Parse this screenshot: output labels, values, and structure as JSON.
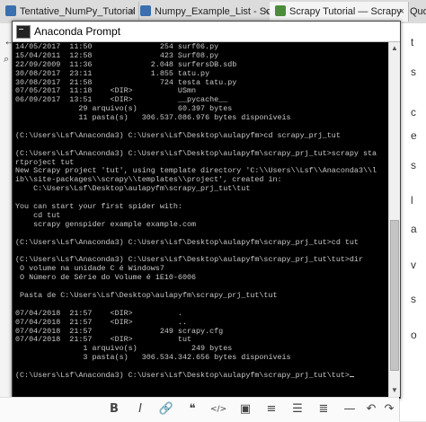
{
  "browser": {
    "tabs": [
      {
        "label": "Tentative_NumPy_Tutorial - S",
        "close": "×"
      },
      {
        "label": "Numpy_Example_List - SciPy",
        "close": "×"
      },
      {
        "label": "Scrapy Tutorial — Scrapy",
        "close": "×"
      },
      {
        "label": "Quo",
        "close": ""
      }
    ],
    "left_glyphs": [
      "←",
      "⌕"
    ],
    "right_glyphs": [
      "t",
      "s",
      "c",
      "e",
      "s",
      "l",
      "a",
      "v",
      "s",
      "o"
    ]
  },
  "window": {
    "title": "Anaconda Prompt",
    "console_lines": [
      "14/05/2017  11:50               254 surf06.py",
      "15/04/2011  12:58               423 Surf08.py",
      "22/09/2009  11:36             2.048 surfersDB.sdb",
      "30/08/2017  23:11             1.855 tatu.py",
      "30/08/2017  21:58               724 testa tatu.py",
      "07/05/2017  11:18    <DIR>          USmn",
      "06/09/2017  13:51    <DIR>          __pycache__",
      "              29 arquivo(s)         60.397 bytes",
      "              11 pasta(s)   306.537.086.976 bytes disponíveis",
      "",
      "(C:\\Users\\Lsf\\Anaconda3) C:\\Users\\Lsf\\Desktop\\aulapyfm>cd scrapy_prj_tut",
      "",
      "(C:\\Users\\Lsf\\Anaconda3) C:\\Users\\Lsf\\Desktop\\aulapyfm\\scrapy_prj_tut>scrapy sta",
      "rtproject tut",
      "New Scrapy project 'tut', using template directory 'C:\\\\Users\\\\Lsf\\\\Anaconda3\\\\l",
      "ib\\\\site-packages\\\\scrapy\\\\templates\\\\project', created in:",
      "    C:\\Users\\Lsf\\Desktop\\aulapyfm\\scrapy_prj_tut\\tut",
      "",
      "You can start your first spider with:",
      "    cd tut",
      "    scrapy genspider example example.com",
      "",
      "(C:\\Users\\Lsf\\Anaconda3) C:\\Users\\Lsf\\Desktop\\aulapyfm\\scrapy_prj_tut>cd tut",
      "",
      "(C:\\Users\\Lsf\\Anaconda3) C:\\Users\\Lsf\\Desktop\\aulapyfm\\scrapy_prj_tut\\tut>dir",
      " O volume na unidade C é Windows7",
      " O Número de Série do Volume é 1E10-6006",
      "",
      " Pasta de C:\\Users\\Lsf\\Desktop\\aulapyfm\\scrapy_prj_tut\\tut",
      "",
      "07/04/2018  21:57    <DIR>          .",
      "07/04/2018  21:57    <DIR>          ..",
      "07/04/2018  21:57               249 scrapy.cfg",
      "07/04/2018  21:57    <DIR>          tut",
      "               1 arquivo(s)            249 bytes",
      "               3 pasta(s)   306.534.342.656 bytes disponíveis",
      "",
      "(C:\\Users\\Lsf\\Anaconda3) C:\\Users\\Lsf\\Desktop\\aulapyfm\\scrapy_prj_tut\\tut>"
    ]
  },
  "editor_toolbar": {
    "buttons": [
      {
        "name": "bold-button",
        "label": "B"
      },
      {
        "name": "italic-button",
        "label": "I"
      },
      {
        "name": "link-button",
        "label": "🔗"
      },
      {
        "name": "quote-button",
        "label": "❝"
      },
      {
        "name": "code-button",
        "label": "</>"
      },
      {
        "name": "image-button",
        "label": "▣"
      },
      {
        "name": "ordered-list-button",
        "label": "≡"
      },
      {
        "name": "bullet-list-button",
        "label": "☰"
      },
      {
        "name": "heading-button",
        "label": "≣"
      },
      {
        "name": "rule-button",
        "label": "—"
      },
      {
        "name": "undo-button",
        "label": "↶"
      },
      {
        "name": "redo-button",
        "label": "↷"
      }
    ]
  },
  "colors": {
    "console_bg": "#000000",
    "console_text": "#c8c8c8",
    "titlebar_bg": "#ffffff"
  }
}
